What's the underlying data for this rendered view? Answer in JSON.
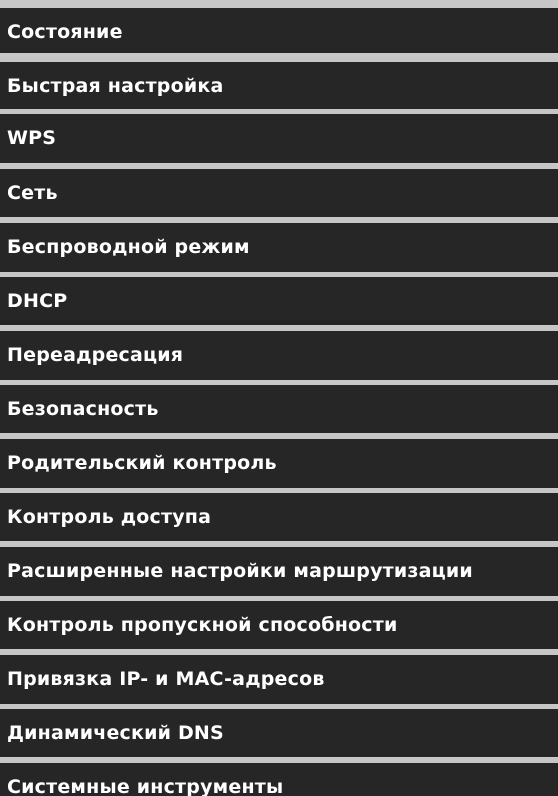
{
  "menu": {
    "items": [
      {
        "label": "Состояние"
      },
      {
        "label": "Быстрая настройка"
      },
      {
        "label": "WPS"
      },
      {
        "label": "Сеть"
      },
      {
        "label": "Беспроводной режим"
      },
      {
        "label": "DHCP"
      },
      {
        "label": "Переадресация"
      },
      {
        "label": "Безопасность"
      },
      {
        "label": "Родительский контроль"
      },
      {
        "label": "Контроль доступа"
      },
      {
        "label": "Расширенные настройки маршрутизации"
      },
      {
        "label": "Контроль пропускной способности"
      },
      {
        "label": "Привязка IP- и MAC-адресов"
      },
      {
        "label": "Динамический DNS"
      },
      {
        "label": "Системные инструменты"
      }
    ],
    "colors": {
      "item_bg": "#262626",
      "separator": "#c6c6c6",
      "text": "#ffffff"
    }
  }
}
